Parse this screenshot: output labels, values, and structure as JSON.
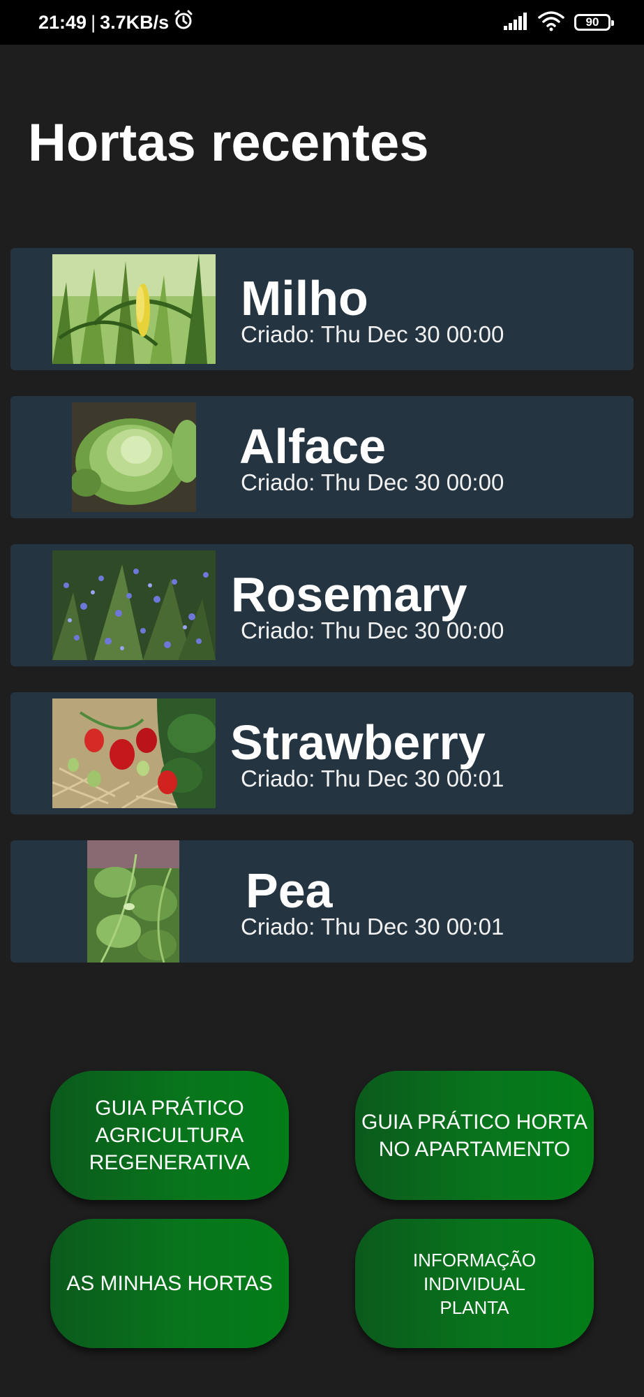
{
  "status_bar": {
    "time": "21:49",
    "separator": "|",
    "speed": "3.7KB/s",
    "icons": [
      "alarm-icon",
      "signal-icon",
      "wifi-icon",
      "battery-icon"
    ],
    "battery_level": "90"
  },
  "page": {
    "title": "Hortas recentes"
  },
  "gardens": [
    {
      "name": "Milho",
      "created": "Criado: Thu Dec 30 00:00",
      "image": "corn-photo"
    },
    {
      "name": "Alface",
      "created": "Criado: Thu Dec 30 00:00",
      "image": "lettuce-photo"
    },
    {
      "name": "Rosemary",
      "created": "Criado: Thu Dec 30 00:00",
      "image": "rosemary-photo"
    },
    {
      "name": "Strawberry",
      "created": "Criado: Thu Dec 30 00:01",
      "image": "strawberry-photo"
    },
    {
      "name": "Pea",
      "created": "Criado: Thu Dec 30 00:01",
      "image": "pea-photo"
    }
  ],
  "buttons": {
    "regenerative_guide": "GUIA PRÁTICO\nAGRICULTURA\nREGENERATIVA",
    "apartment_guide": "GUIA PRÁTICO HORTA\nNO APARTAMENTO",
    "my_gardens": "AS MINHAS HORTAS",
    "plant_info": "INFORMAÇÃO\nINDIVIDUAL\nPLANTA"
  },
  "colors": {
    "background": "#1e1e1e",
    "card": "#243440",
    "button_green": "#08751c",
    "status_bar": "#000000"
  }
}
